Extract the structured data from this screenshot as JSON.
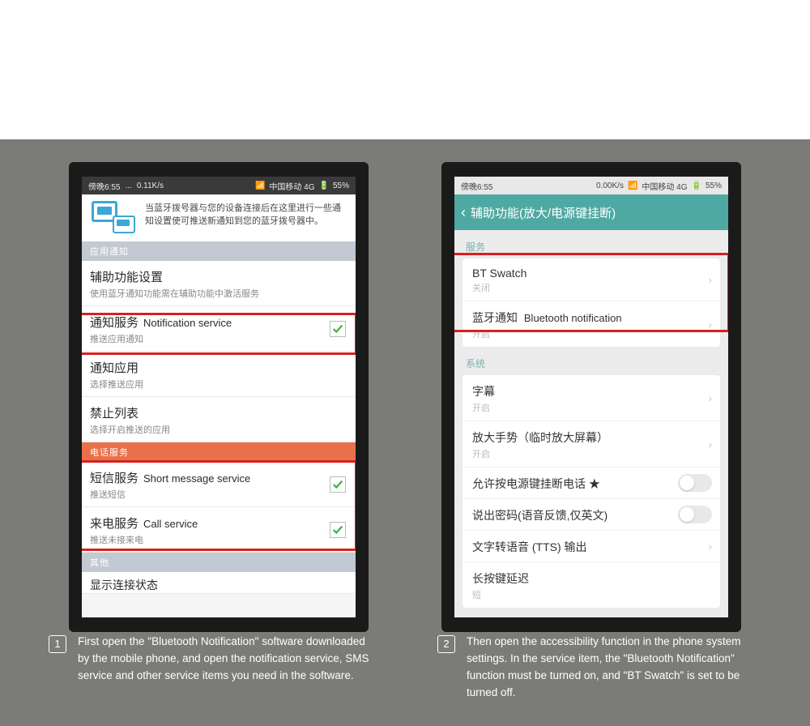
{
  "status_bar": {
    "time": "傍晚6:55",
    "speed1": "0.11K/s",
    "speed2": "0.00K/s",
    "carrier": "中国移动 4G",
    "battery": "55%"
  },
  "screen1": {
    "intro": "当蓝牙拨号器与您的设备连接后在这里进行一些通知设置使可推送新通知到您的蓝牙拨号器中。",
    "sections": {
      "app": "应用通知",
      "phone": "电话服务",
      "other": "其他"
    },
    "rows": {
      "accessibility": {
        "title": "辅助功能设置",
        "sub": "使用蓝牙通知功能需在辅助功能中激活服务"
      },
      "notif_service": {
        "title": "通知服务",
        "en": "Notification service",
        "sub": "推送应用通知"
      },
      "notif_app": {
        "title": "通知应用",
        "sub": "选择推送应用"
      },
      "blocklist": {
        "title": "禁止列表",
        "sub": "选择开启推送的应用"
      },
      "sms": {
        "title": "短信服务",
        "en": "Short message service",
        "sub": "推送短信"
      },
      "call": {
        "title": "来电服务",
        "en": "Call service",
        "sub": "推送未接来电"
      },
      "truncated": {
        "title": "显示连接状态"
      }
    }
  },
  "screen2": {
    "header": "辅助功能(放大/电源键挂断)",
    "lbl_service": "服务",
    "lbl_system": "系统",
    "rows": {
      "bt_swatch": {
        "title": "BT Swatch",
        "sub": "关闭"
      },
      "bt_notif": {
        "title": "蓝牙通知",
        "extra": "Bluetooth notification",
        "sub": "开启"
      },
      "caption": {
        "title": "字幕",
        "sub": "开启"
      },
      "magnify": {
        "title": "放大手势（临时放大屏幕）",
        "sub": "开启"
      },
      "power_hang": {
        "title": "允许按电源键挂断电话 ★"
      },
      "speak_pw": {
        "title": "说出密码(语音反馈,仅英文)"
      },
      "tts": {
        "title": "文字转语音 (TTS) 输出"
      },
      "longpress": {
        "title": "长按键延迟",
        "sub": "短"
      }
    }
  },
  "captions": {
    "c1_num": "1",
    "c1": "First open the \"Bluetooth Notification\" software downloaded by the mobile phone, and open the notification service, SMS service and other service items you need in the software.",
    "c2_num": "2",
    "c2": "Then open the accessibility function in the phone system settings. In the service item, the \"Bluetooth Notification\" function must be turned on, and \"BT Swatch\" is set to be turned off."
  }
}
